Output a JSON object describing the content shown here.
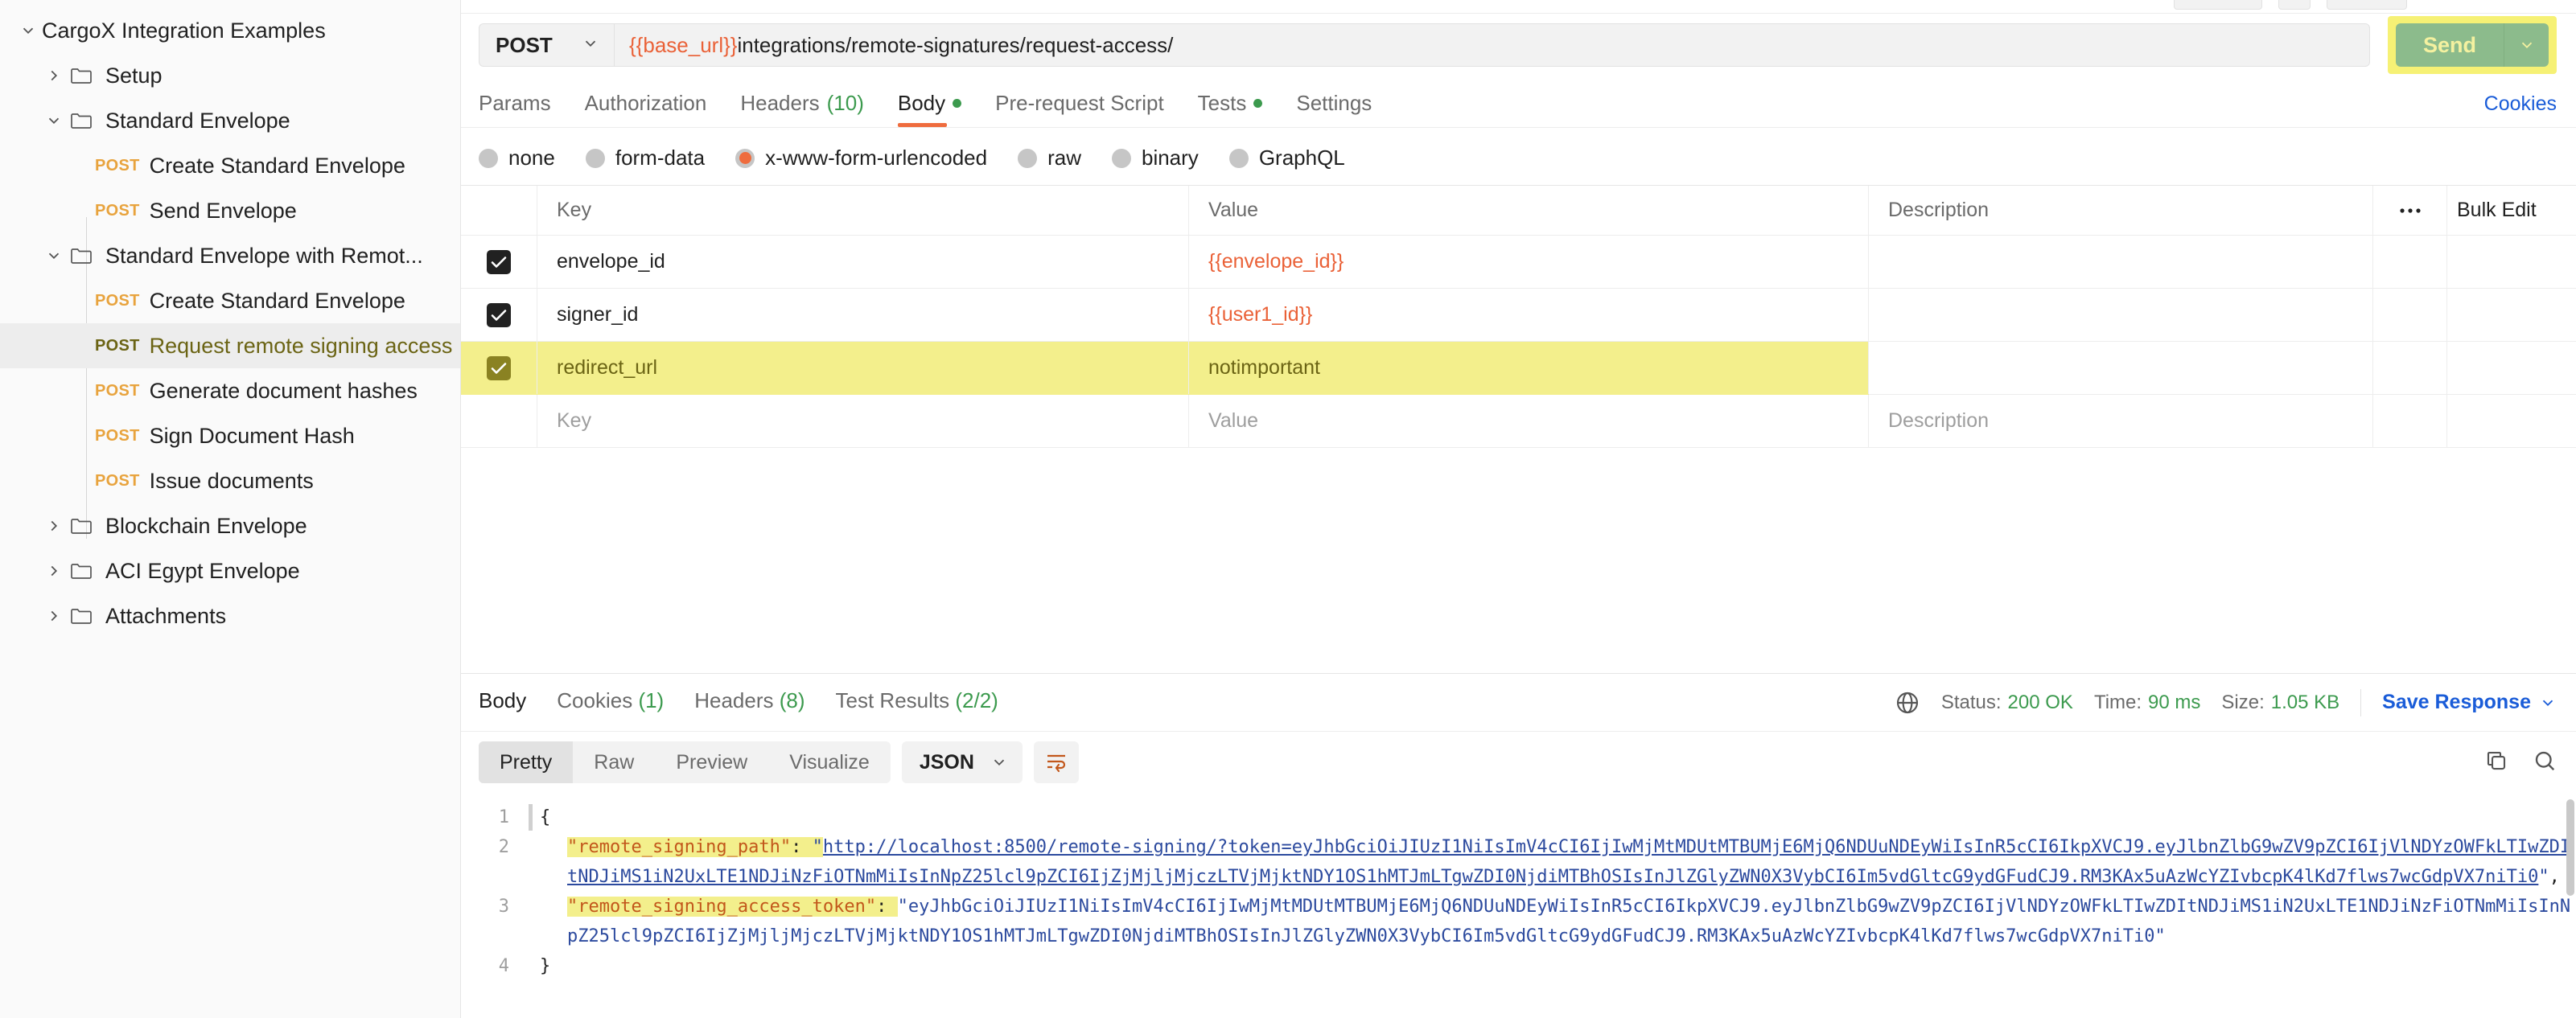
{
  "sidebar": {
    "root": {
      "label": "CargoX Integration Examples",
      "expanded": true
    },
    "items": [
      {
        "label": "Setup",
        "type": "folder",
        "depth": 1,
        "expanded": false
      },
      {
        "label": "Standard Envelope",
        "type": "folder",
        "depth": 1,
        "expanded": true
      },
      {
        "label": "Create Standard Envelope",
        "type": "request",
        "method": "POST",
        "depth": 2
      },
      {
        "label": "Send Envelope",
        "type": "request",
        "method": "POST",
        "depth": 2
      },
      {
        "label": "Standard Envelope with Remot...",
        "type": "folder",
        "depth": 1,
        "expanded": true
      },
      {
        "label": "Create Standard Envelope",
        "type": "request",
        "method": "POST",
        "depth": 2
      },
      {
        "label": "Request remote signing access",
        "type": "request",
        "method": "POST",
        "depth": 2,
        "selected": true,
        "highlighted": true
      },
      {
        "label": "Generate document hashes",
        "type": "request",
        "method": "POST",
        "depth": 2
      },
      {
        "label": "Sign Document Hash",
        "type": "request",
        "method": "POST",
        "depth": 2
      },
      {
        "label": "Issue documents",
        "type": "request",
        "method": "POST",
        "depth": 2
      },
      {
        "label": "Blockchain Envelope",
        "type": "folder",
        "depth": 1,
        "expanded": false
      },
      {
        "label": "ACI Egypt Envelope",
        "type": "folder",
        "depth": 1,
        "expanded": false
      },
      {
        "label": "Attachments",
        "type": "folder",
        "depth": 1,
        "expanded": false
      }
    ]
  },
  "request": {
    "method": "POST",
    "url_variable": "{{base_url}}",
    "url_rest": "integrations/remote-signatures/request-access/",
    "send_label": "Send",
    "tabs": [
      {
        "label": "Params",
        "active": false
      },
      {
        "label": "Authorization",
        "active": false
      },
      {
        "label": "Headers",
        "count": "(10)",
        "active": false
      },
      {
        "label": "Body",
        "active": true,
        "dot": true
      },
      {
        "label": "Pre-request Script",
        "active": false
      },
      {
        "label": "Tests",
        "active": false,
        "dot": true
      },
      {
        "label": "Settings",
        "active": false
      }
    ],
    "cookies_link": "Cookies",
    "body_types": [
      {
        "label": "none",
        "selected": false
      },
      {
        "label": "form-data",
        "selected": false
      },
      {
        "label": "x-www-form-urlencoded",
        "selected": true
      },
      {
        "label": "raw",
        "selected": false
      },
      {
        "label": "binary",
        "selected": false
      },
      {
        "label": "GraphQL",
        "selected": false
      }
    ],
    "table": {
      "headers": {
        "key": "Key",
        "value": "Value",
        "description": "Description",
        "bulk_edit": "Bulk Edit"
      },
      "rows": [
        {
          "checked": true,
          "key": "envelope_id",
          "value": "{{envelope_id}}",
          "description": "",
          "is_variable": true,
          "highlighted": false
        },
        {
          "checked": true,
          "key": "signer_id",
          "value": "{{user1_id}}",
          "description": "",
          "is_variable": true,
          "highlighted": false
        },
        {
          "checked": true,
          "key": "redirect_url",
          "value": "notimportant",
          "description": "",
          "is_variable": false,
          "highlighted": true
        }
      ],
      "placeholder_row": {
        "key": "Key",
        "value": "Value",
        "description": "Description"
      }
    }
  },
  "response": {
    "tabs": [
      {
        "label": "Body",
        "active": true
      },
      {
        "label": "Cookies",
        "count": "(1)",
        "active": false
      },
      {
        "label": "Headers",
        "count": "(8)",
        "active": false
      },
      {
        "label": "Test Results",
        "count": "(2/2)",
        "active": false
      }
    ],
    "status_label": "Status:",
    "status_value": "200 OK",
    "time_label": "Time:",
    "time_value": "90 ms",
    "size_label": "Size:",
    "size_value": "1.05 KB",
    "save_response": "Save Response",
    "view_modes": [
      {
        "label": "Pretty",
        "active": true
      },
      {
        "label": "Raw",
        "active": false
      },
      {
        "label": "Preview",
        "active": false
      },
      {
        "label": "Visualize",
        "active": false
      }
    ],
    "format": "JSON",
    "code_lines": [
      {
        "n": "1",
        "segments": [
          {
            "t": "{",
            "c": "p"
          }
        ]
      },
      {
        "n": "2",
        "indent": true,
        "segments": [
          {
            "t": "\"remote_signing_path\"",
            "c": "k",
            "hl": true
          },
          {
            "t": ": ",
            "c": "p",
            "hl": true
          },
          {
            "t": "\"",
            "c": "s",
            "hl": true
          },
          {
            "t": "http://localhost:8500/remote-signing/?token=eyJhbGciOiJIUzI1NiIsImV4cCI6IjIwMjMtMDUtMTBUMjE6MjQ6NDUuNDEyWiIsInR5cCI6IkpXVCJ9.eyJlbnZlbG9wZV9pZCI6IjVlNDYzOWFkLTIwZDItNDJiMS1iN2UxLTE1NDJiNzFiOTNmMiIsInNpZ25lcl9pZCI6IjZjMjljMjczLTVjMjktNDY1OS1hMTJmLTgwZDI0NjdiMTBhOSIsInJlZGlyZWN0X3VybCI6Im5vdGltcG9ydGFudCJ9.RM3KAx5uAzWcYZIvbcpK4lKd7flws7wcGdpVX7niTi0",
            "c": "lnk"
          },
          {
            "t": "\"",
            "c": "s"
          },
          {
            "t": ",",
            "c": "p"
          }
        ]
      },
      {
        "n": "3",
        "indent": true,
        "segments": [
          {
            "t": "\"remote_signing_access_token\"",
            "c": "k",
            "hl": true
          },
          {
            "t": ": ",
            "c": "p",
            "hl": true
          },
          {
            "t": "\"eyJhbGciOiJIUzI1NiIsImV4cCI6IjIwMjMtMDUtMTBUMjE6MjQ6NDUuNDEyWiIsInR5cCI6IkpXVCJ9.eyJlbnZlbG9wZV9pZCI6IjVlNDYzOWFkLTIwZDItNDJiMS1iN2UxLTE1NDJiNzFiOTNmMiIsInNpZ25lcl9pZCI6IjZjMjljMjczLTVjMjktNDY1OS1hMTJmLTgwZDI0NjdiMTBhOSIsInJlZGlyZWN0X3VybCI6Im5vdGltcG9ydGFudCJ9.RM3KAx5uAzWcYZIvbcpK4lKd7flws7wcGdpVX7niTi0\"",
            "c": "s"
          }
        ]
      },
      {
        "n": "4",
        "segments": [
          {
            "t": "}",
            "c": "p"
          }
        ]
      }
    ]
  }
}
